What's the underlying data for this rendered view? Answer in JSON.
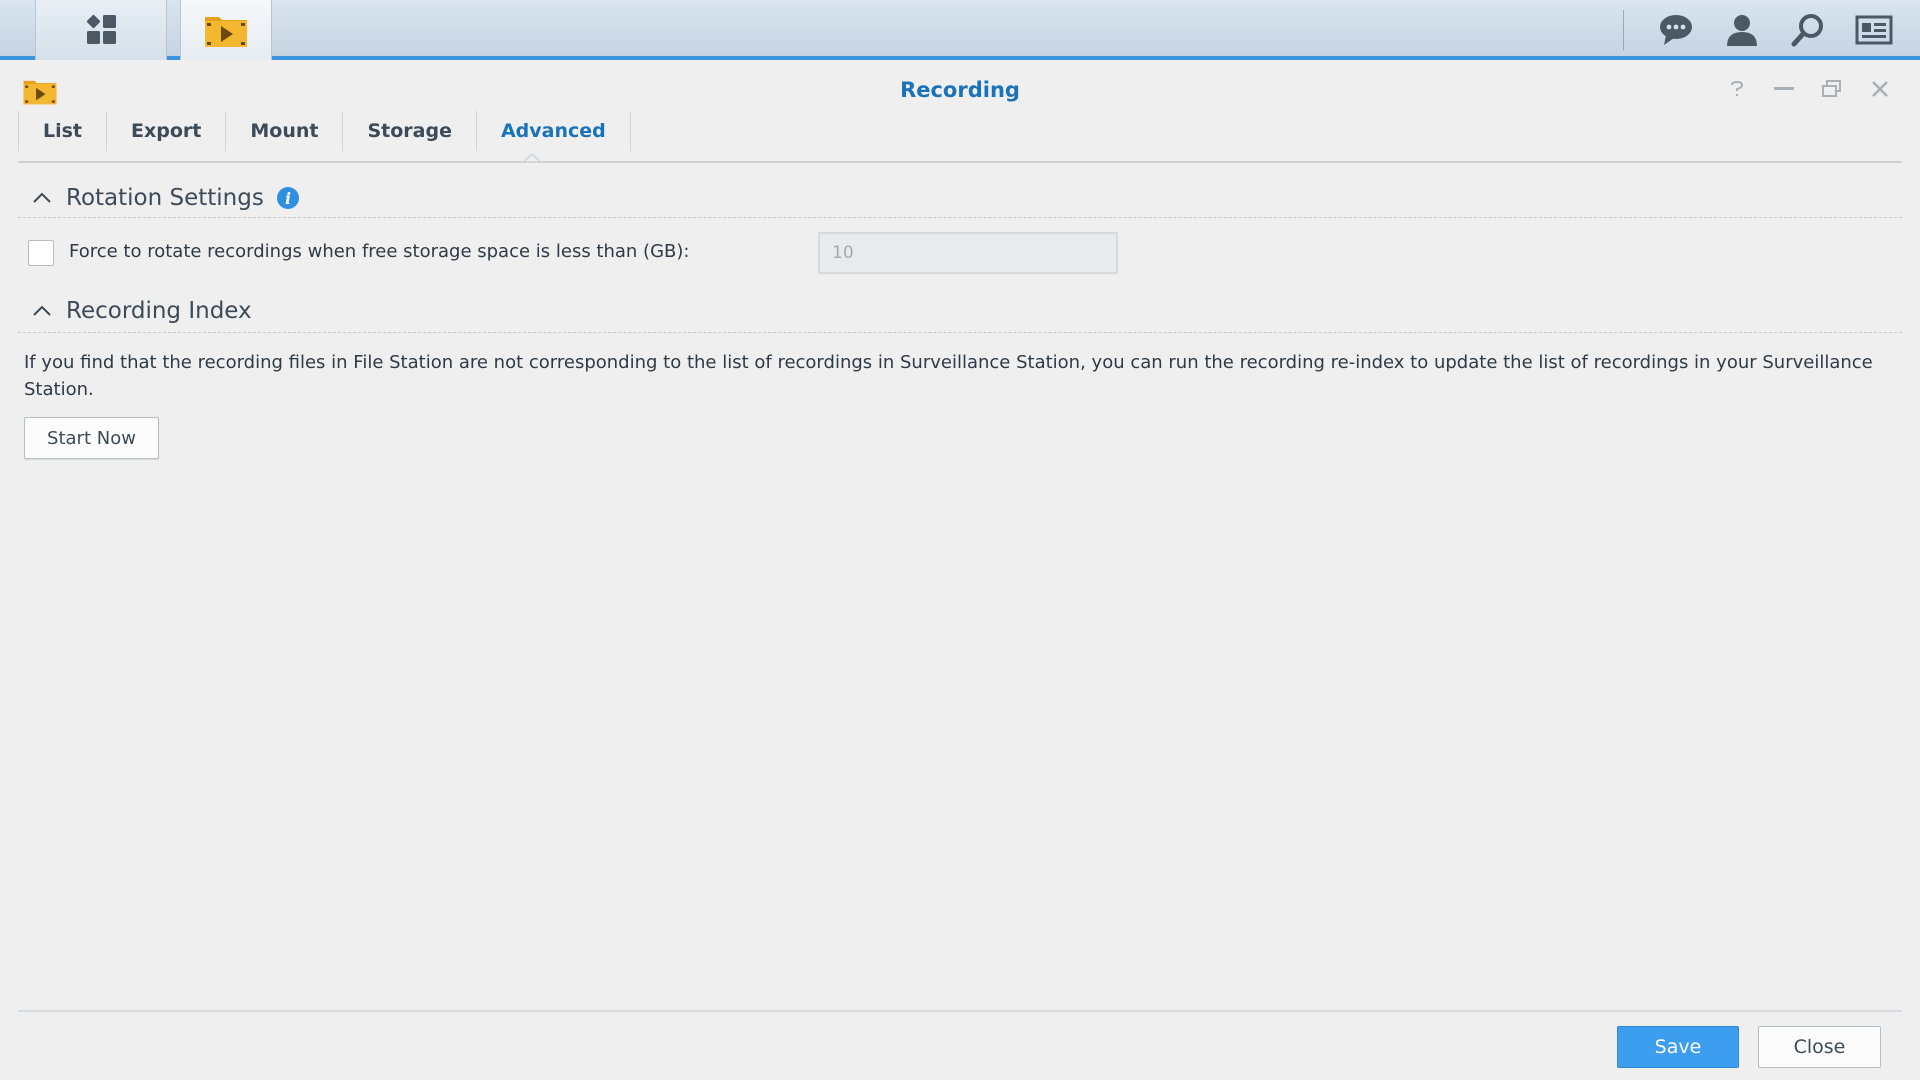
{
  "taskbar": {
    "icons": [
      "main-menu-icon",
      "surveillance-app-icon",
      "chat-icon",
      "user-icon",
      "search-icon",
      "widgets-icon"
    ]
  },
  "window": {
    "title": "Recording",
    "controls": [
      "help-icon",
      "minimize-icon",
      "restore-icon",
      "close-icon"
    ]
  },
  "tabs": [
    {
      "label": "List"
    },
    {
      "label": "Export"
    },
    {
      "label": "Mount"
    },
    {
      "label": "Storage"
    },
    {
      "label": "Advanced",
      "active": true
    }
  ],
  "rotation": {
    "title": "Rotation Settings",
    "checkbox_label": "Force to rotate recordings when free storage space is less than (GB):",
    "checked": false,
    "gb_value": "10"
  },
  "index": {
    "title": "Recording Index",
    "description": "If you find that the recording files in File Station are not corresponding to the list of recordings in Surveillance Station, you can run the recording re-index to update the list of recordings in your Surveillance Station.",
    "start_button": "Start Now"
  },
  "footer": {
    "save_label": "Save",
    "close_label": "Close"
  },
  "colors": {
    "accent": "#1a73b8",
    "primary_button": "#3d9ef0",
    "taskbar_border": "#3b94de",
    "info_icon": "#2f8fe0"
  }
}
